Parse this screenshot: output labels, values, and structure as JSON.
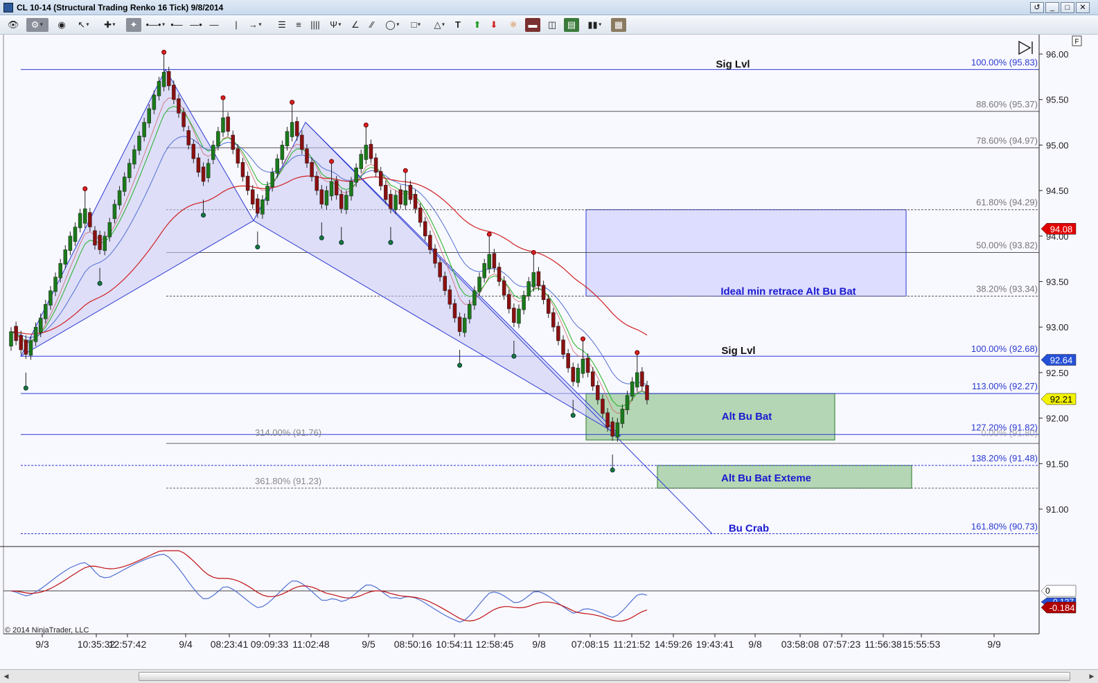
{
  "window": {
    "title": "CL 10-14 (Structural Trading Renko 16 Tick)  9/8/2014"
  },
  "toolbar": {
    "icons": [
      "eye-icon",
      "data-box-icon",
      "visibility-icon",
      "pointer-icon",
      "crosshair-icon",
      "pin-icon",
      "line-tools-icon",
      "ray-icon",
      "extended-line-icon",
      "horizontal-line-icon",
      "vertical-line-icon",
      "arrow-line-icon",
      "fibonacci-retracement-icon",
      "fibonacci-extension-icon",
      "fibonacci-time-icon",
      "pitchfork-icon",
      "gann-fan-icon",
      "regression-channel-icon",
      "ellipse-icon",
      "rectangle-icon",
      "triangle-icon",
      "text-icon",
      "arrow-up-icon",
      "arrow-down-icon",
      "strategy-icon",
      "delete-drawings-icon",
      "chart-trader-icon",
      "bar-type-icon",
      "chart-style-icon",
      "properties-icon"
    ]
  },
  "chart_data": {
    "type": "candlestick",
    "instrument": "CL 10-14",
    "bar_type": "Structural Trading Renko 16 Tick",
    "date": "9/8/2014",
    "y_axis": {
      "ylim": [
        90.55,
        96.15
      ],
      "ticks": [
        "96.00",
        "95.50",
        "95.00",
        "94.50",
        "94.00",
        "93.50",
        "93.00",
        "92.50",
        "92.00",
        "91.50",
        "91.00"
      ],
      "tick_values": [
        96.0,
        95.5,
        95.0,
        94.5,
        94.0,
        93.5,
        93.0,
        92.5,
        92.0,
        91.5,
        91.0
      ]
    },
    "x_axis": {
      "labels": [
        "9/3",
        "10:35:32",
        "12:57:42",
        "9/4",
        "08:23:41",
        "09:09:33",
        "11:02:48",
        "9/5",
        "08:50:16",
        "10:54:11",
        "12:58:45",
        "9/8",
        "07:08:15",
        "11:21:52",
        "14:59:26",
        "19:43:41",
        "9/8",
        "03:58:08",
        "07:57:23",
        "11:56:38",
        "15:55:53",
        "9/9"
      ]
    },
    "price_markers": [
      {
        "value": "94.08",
        "color": "#e00000"
      },
      {
        "value": "92.64",
        "color": "#2550d8"
      },
      {
        "value": "92.21",
        "color": "#f3f300"
      }
    ],
    "upper_fib_levels": [
      {
        "label": "100.00% (95.83)",
        "price": 95.83
      },
      {
        "label": "88.60% (95.37)",
        "price": 95.37
      },
      {
        "label": "78.60% (94.97)",
        "price": 94.97
      },
      {
        "label": "61.80% (94.29)",
        "price": 94.29
      },
      {
        "label": "50.00% (93.82)",
        "price": 93.82
      },
      {
        "label": "38.20% (93.34)",
        "price": 93.34
      }
    ],
    "lower_fib_levels": [
      {
        "label": "100.00% (92.68)",
        "price": 92.68
      },
      {
        "label": "113.00% (92.27)",
        "price": 92.27
      },
      {
        "label": "127.20% (91.82)",
        "price": 91.82
      },
      {
        "label": "138.20% (91.48)",
        "price": 91.48
      },
      {
        "label": "161.80% (90.73)",
        "price": 90.73
      }
    ],
    "extension_labels": [
      {
        "label": "314.00% (91.76)",
        "price": 91.76
      },
      {
        "label": "361.80% (91.23)",
        "price": 91.23
      }
    ],
    "hidden_label": "0.00% (91.80)",
    "annotations": {
      "sig_lvl_top": "Sig Lvl",
      "sig_lvl_mid": "Sig Lvl",
      "ideal_zone": "Ideal min retrace Alt Bu Bat",
      "alt_bu_bat": "Alt Bu Bat",
      "alt_bu_bat_extreme": "Alt Bu Bat Exteme",
      "bu_crab": "Bu Crab"
    },
    "zones": [
      {
        "name": "ideal-min-retrace",
        "top": 94.29,
        "bottom": 93.34,
        "color": "#d8d8ff"
      },
      {
        "name": "alt-bu-bat",
        "top": 92.27,
        "bottom": 91.76,
        "color": "#a8d0a8"
      },
      {
        "name": "alt-bu-bat-extreme",
        "top": 91.48,
        "bottom": 91.23,
        "color": "#a8d0a8"
      }
    ],
    "pattern_points": [
      {
        "x": 0,
        "price": 92.68
      },
      {
        "x": 1,
        "price": 95.83
      },
      {
        "x": 2,
        "price": 94.17
      },
      {
        "x": 3,
        "price": 95.25
      },
      {
        "x": 4,
        "price": 91.8
      }
    ],
    "closes": [
      92.95,
      92.85,
      92.75,
      92.7,
      92.85,
      93.0,
      93.1,
      93.25,
      93.4,
      93.55,
      93.7,
      93.85,
      94.0,
      94.1,
      94.25,
      94.3,
      94.1,
      93.9,
      93.85,
      94.0,
      94.15,
      94.35,
      94.5,
      94.65,
      94.8,
      94.95,
      95.1,
      95.25,
      95.4,
      95.55,
      95.7,
      95.8,
      95.65,
      95.5,
      95.35,
      95.2,
      95.0,
      94.85,
      94.7,
      94.6,
      94.8,
      95.0,
      95.15,
      95.3,
      95.15,
      94.95,
      94.8,
      94.65,
      94.5,
      94.35,
      94.25,
      94.4,
      94.55,
      94.7,
      94.85,
      95.0,
      95.15,
      95.25,
      95.1,
      94.95,
      94.8,
      94.65,
      94.5,
      94.35,
      94.5,
      94.6,
      94.45,
      94.3,
      94.45,
      94.6,
      94.75,
      94.9,
      95.0,
      94.85,
      94.7,
      94.55,
      94.4,
      94.3,
      94.45,
      94.35,
      94.5,
      94.4,
      94.3,
      94.15,
      94.0,
      93.85,
      93.7,
      93.55,
      93.4,
      93.25,
      93.1,
      92.95,
      93.1,
      93.25,
      93.4,
      93.55,
      93.7,
      93.8,
      93.65,
      93.5,
      93.35,
      93.2,
      93.05,
      93.2,
      93.35,
      93.5,
      93.6,
      93.45,
      93.3,
      93.15,
      93.0,
      92.85,
      92.7,
      92.55,
      92.4,
      92.55,
      92.65,
      92.5,
      92.35,
      92.2,
      92.05,
      91.9,
      91.8,
      91.95,
      92.1,
      92.25,
      92.4,
      92.5,
      92.35,
      92.2
    ],
    "oscillator": {
      "zero_label": "0",
      "value_blue": "-0.127",
      "value_red": "-0.184"
    },
    "copyright": "© 2014 NinjaTrader, LLC"
  }
}
